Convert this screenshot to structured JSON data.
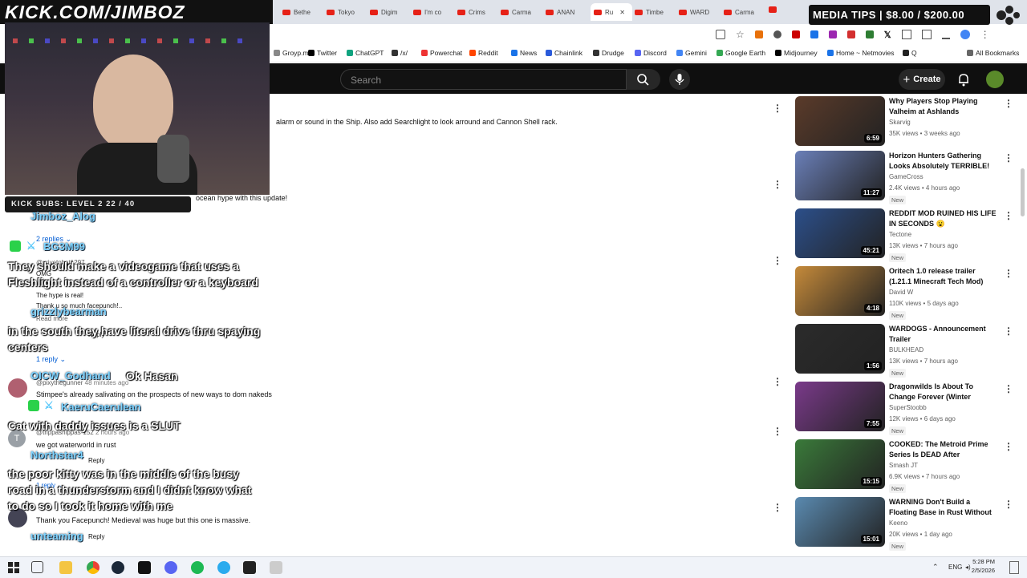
{
  "overlay": {
    "banner": "KICK.COM/JIMBOZ",
    "media_tips": "MEDIA TIPS | $8.00 / $200.00",
    "kick_subs": "KICK SUBS: LEVEL 2 22 / 40",
    "chat": [
      {
        "user": "Jimboz_Alog",
        "message": ""
      },
      {
        "user": "BG3M99",
        "message": "They should make a videogame that uses a Fleshlight instead of a controller or a keyboard"
      },
      {
        "user": "grizzlybearman",
        "message": "in the south they have literal drive thru spaying centers"
      },
      {
        "user": "OICW_Godhand",
        "message": "Ok Hasan"
      },
      {
        "user": "KaeruCaerulean",
        "message": "Cat with daddy issues is a SLUT"
      },
      {
        "user": "Northstar4",
        "message": "the poor kitty was in the middle of the busy road in a thunderstorm and I didnt know what to do so I took it home with me"
      },
      {
        "user": "unteaming",
        "message": ""
      }
    ]
  },
  "browser": {
    "tabs": [
      "Bethe",
      "Tokyo",
      "Digim",
      "I'm co",
      "Crims",
      "Carma",
      "ANAN",
      "Ru",
      "Timbe",
      "WARD",
      "Carma"
    ],
    "active_tab_index": 7,
    "bookmarks": [
      "Groyp.me",
      "Twitter",
      "ChatGPT",
      "/x/",
      "Powerchat",
      "Reddit",
      "News",
      "Chainlink",
      "Drudge",
      "Discord",
      "Gemini",
      "Google Earth",
      "Midjourney",
      "Home ~ Netmovies",
      "Q",
      "All Bookmarks"
    ]
  },
  "youtube": {
    "search_placeholder": "Search",
    "create_label": "Create"
  },
  "comments": {
    "top_text": "alarm or sound in the Ship. Also add Searchlight to look arround and Cannon Shell rack.",
    "hype_text": "ocean hype with this update!",
    "replies_2": "2 replies",
    "user_1": "@xrivetphat1297",
    "omg": "OMG",
    "hype_real": "The hype is real!",
    "thanks": "Thank u so much facepunch!..",
    "read_more": "Read more",
    "reply_label": "Reply",
    "replies_1a": "1 reply",
    "user_2": "@pixythegunner",
    "user_2_time": "48 minutes ago",
    "stimpee": "Stimpee's already salivating on the prospects of new ways to dom nakeds",
    "user_3": "@trippashippas-152",
    "user_3_time": "2 hours ago",
    "waterworld": "we got waterworld in rust",
    "replies_1b": "1 reply",
    "medieval": "Thank you Facepunch! Medieval was huge but this one is massive."
  },
  "sidebar_videos": [
    {
      "title": "Why Players Stop Playing Valheim at Ashlands",
      "channel": "Skarvig",
      "meta": "35K views • 3 weeks ago",
      "duration": "6:59",
      "new": "",
      "color": "#5b3b2a"
    },
    {
      "title": "Horizon Hunters Gathering Looks Absolutely TERRIBLE!",
      "channel": "GameCross",
      "meta": "2.4K views • 4 hours ago",
      "duration": "11:27",
      "new": "New",
      "color": "#6a7fb8"
    },
    {
      "title": "REDDIT MOD RUINED HIS LIFE IN SECONDS 😮",
      "channel": "Tectone",
      "meta": "13K views • 7 hours ago",
      "duration": "45:21",
      "new": "New",
      "color": "#2c4f8a"
    },
    {
      "title": "Oritech 1.0 release trailer (1.21.1 Minecraft Tech Mod)",
      "channel": "David W",
      "meta": "110K views • 5 days ago",
      "duration": "4:18",
      "new": "New",
      "color": "#c58a3a"
    },
    {
      "title": "WARDOGS - Announcement Trailer",
      "channel": "BULKHEAD",
      "meta": "13K views • 7 hours ago",
      "duration": "1:56",
      "new": "New",
      "color": "#2b2b2b"
    },
    {
      "title": "Dragonwilds Is About To Change Forever (Winter Summ...",
      "channel": "SuperStoobb",
      "meta": "12K views • 6 days ago",
      "duration": "7:55",
      "new": "New",
      "color": "#7a3a8a"
    },
    {
      "title": "COOKED: The Metroid Prime Series Is DEAD After MASSIVE...",
      "channel": "Smash JT",
      "meta": "6.9K views • 7 hours ago",
      "duration": "15:15",
      "new": "New",
      "color": "#3a7a3a"
    },
    {
      "title": "WARNING Don't Build a Floating Base in Rust Without Watchin...",
      "channel": "Keeno",
      "meta": "20K views • 1 day ago",
      "duration": "15:01",
      "new": "New",
      "color": "#5a8ab0"
    }
  ],
  "taskbar": {
    "lang": "ENG",
    "time": "5:28 PM",
    "date": "2/5/2026"
  }
}
